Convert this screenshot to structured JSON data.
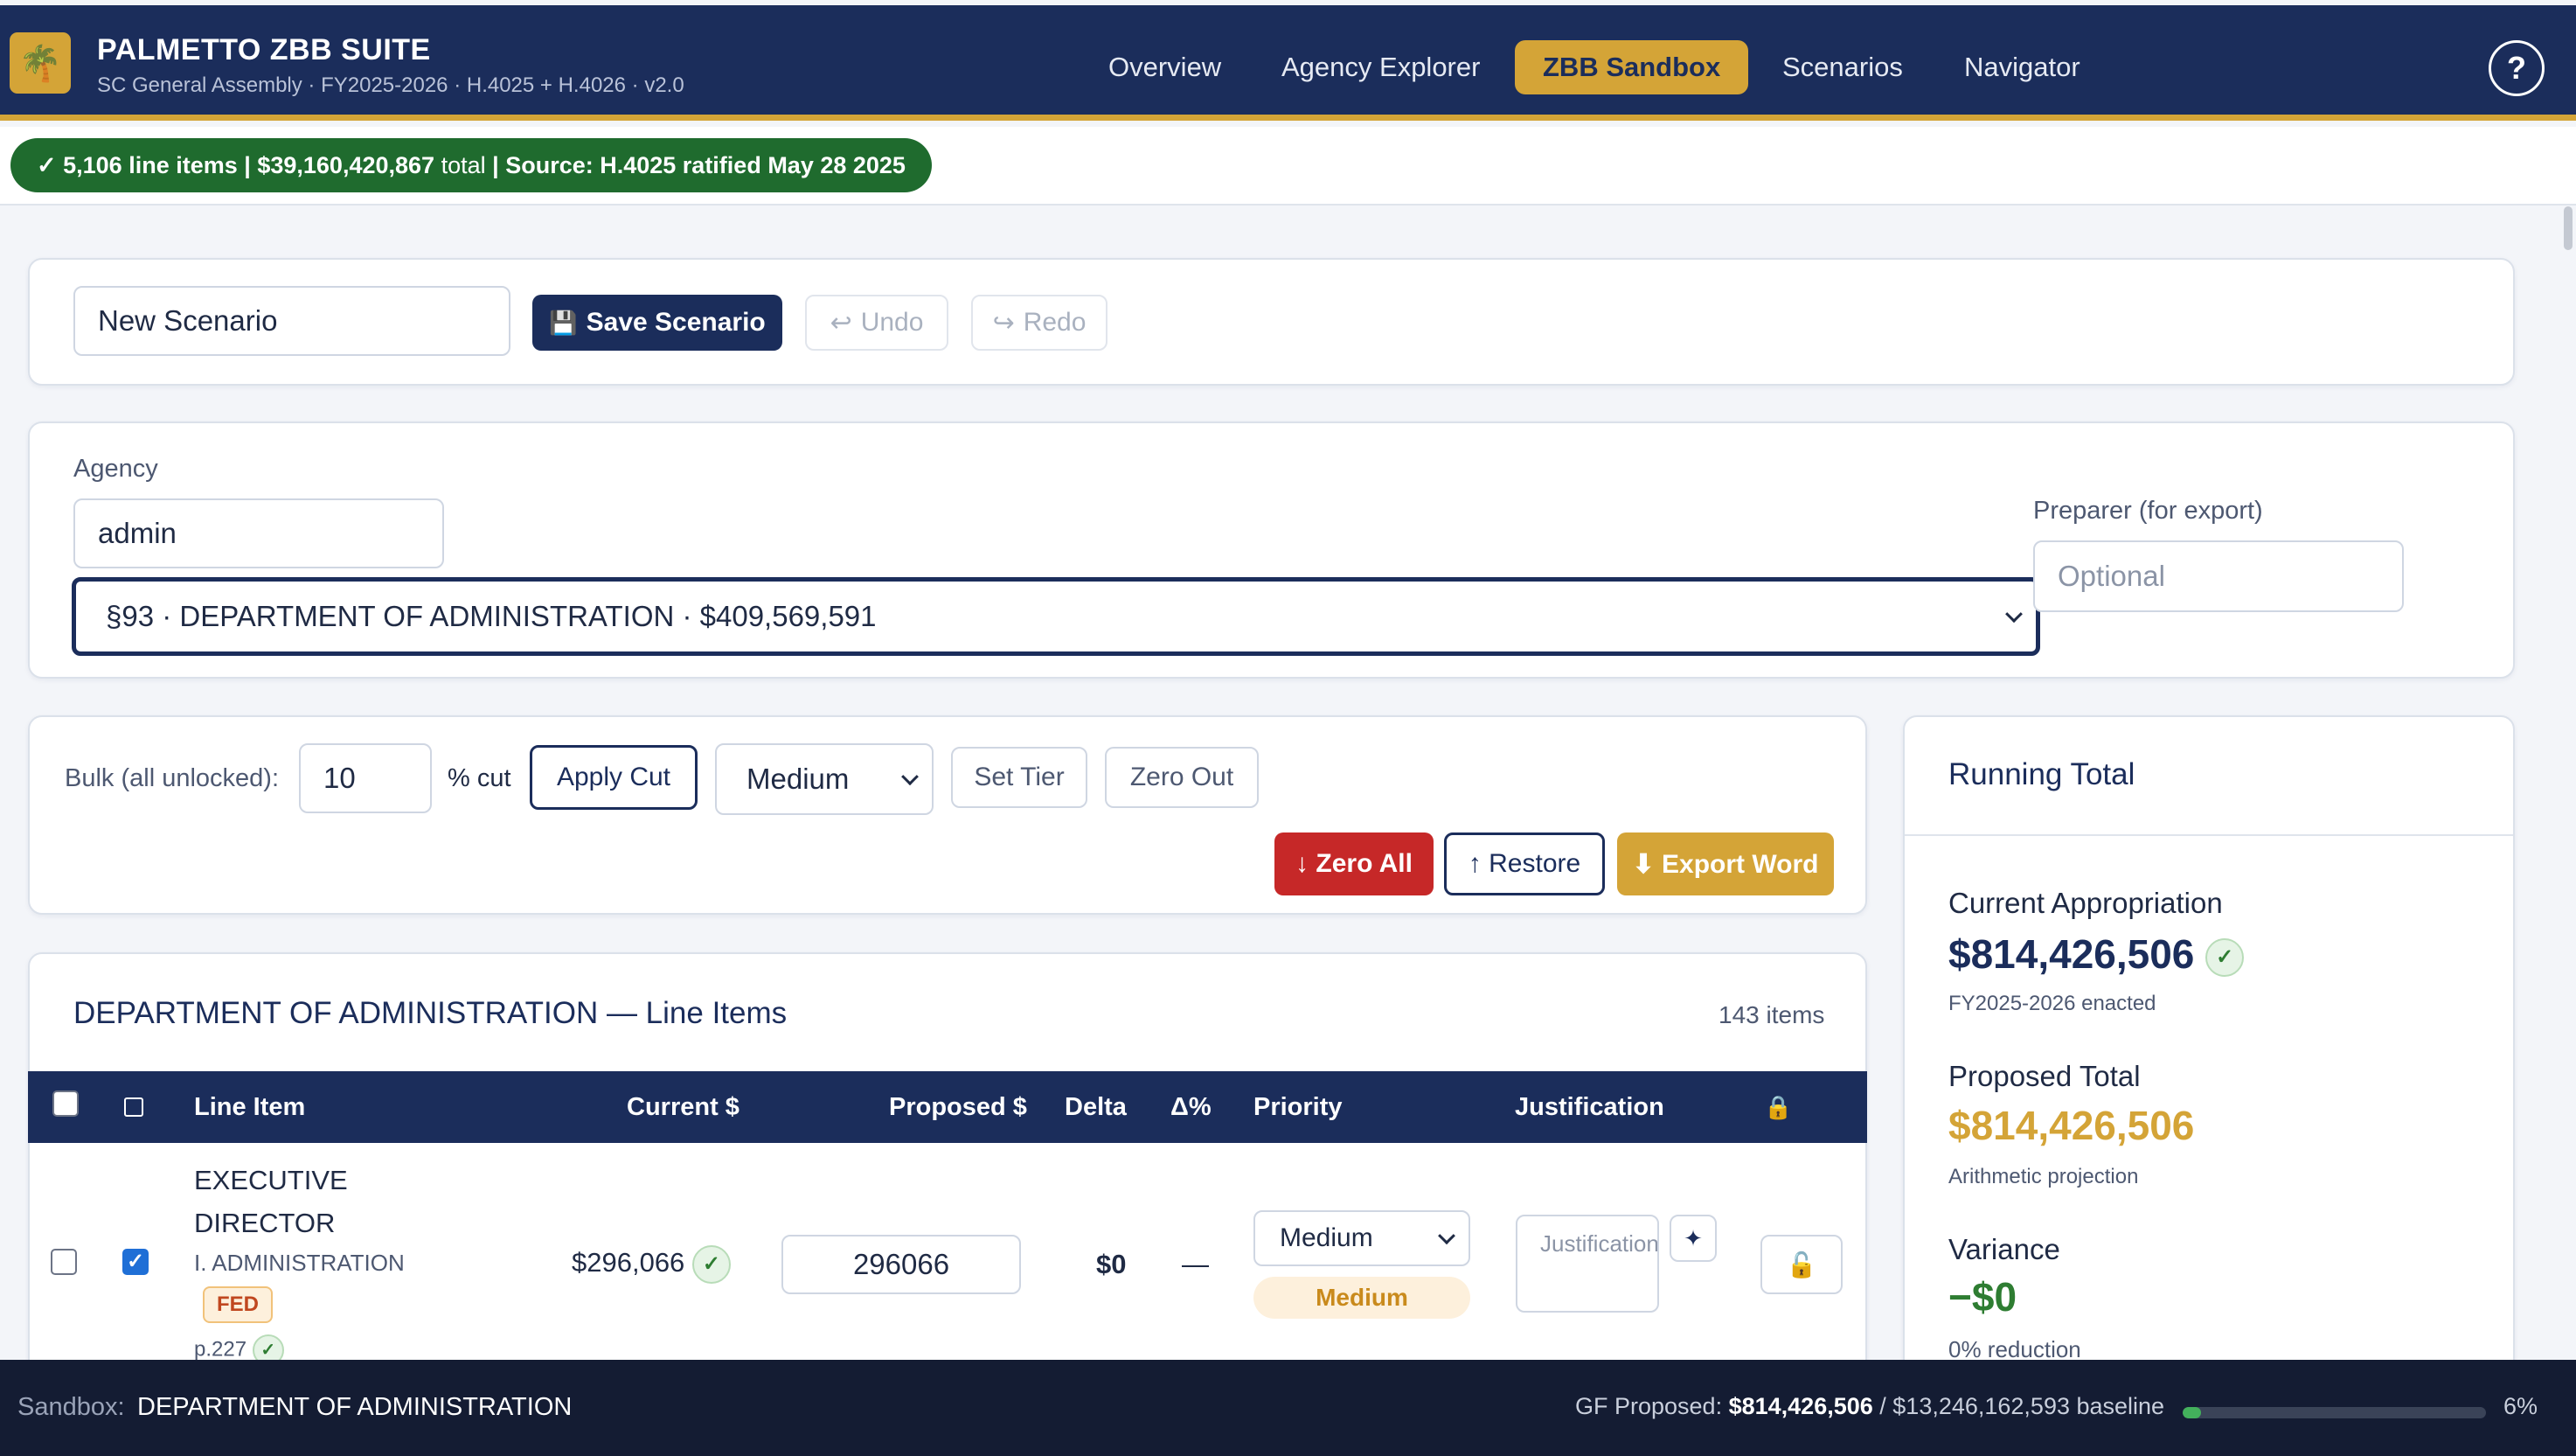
{
  "app": {
    "title": "PALMETTO ZBB SUITE",
    "subtitle": "SC General Assembly · FY2025-2026 · H.4025 + H.4026 · v2.0",
    "nav": [
      "Overview",
      "Agency Explorer",
      "ZBB Sandbox",
      "Scenarios",
      "Navigator"
    ],
    "active_nav": "ZBB Sandbox",
    "help": "?"
  },
  "status": {
    "line_items": "✓ 5,106 line items",
    "sep1": "|",
    "total_amount": "$39,160,420,867",
    "total_word": "total",
    "sep2": "|",
    "source": "Source: H.4025 ratified May 28 2025"
  },
  "scenario": {
    "name_value": "New Scenario",
    "save_label": "Save Scenario",
    "undo_label": "Undo",
    "redo_label": "Redo"
  },
  "agency": {
    "label": "Agency",
    "search_value": "admin",
    "selected": "§93 · DEPARTMENT OF ADMINISTRATION · $409,569,591",
    "preparer_label": "Preparer (for export)",
    "preparer_placeholder": "Optional"
  },
  "bulk": {
    "label": "Bulk (all unlocked):",
    "percent_value": "10",
    "percent_suffix": "% cut",
    "apply_label": "Apply Cut",
    "tier_value": "Medium",
    "set_tier_label": "Set Tier",
    "zero_out_label": "Zero Out",
    "zero_all_label": "↓ Zero All",
    "restore_label": "↑ Restore",
    "export_label": "⬇ Export Word"
  },
  "line_items": {
    "title": "DEPARTMENT OF ADMINISTRATION — Line Items",
    "count": "143 items",
    "headers": {
      "line_item": "Line Item",
      "current": "Current $",
      "proposed": "Proposed $",
      "delta": "Delta",
      "delta_pct": "Δ%",
      "priority": "Priority",
      "justification": "Justification",
      "lock": "🔒"
    },
    "rows": [
      {
        "name_line1": "EXECUTIVE",
        "name_line2": "DIRECTOR",
        "program": "I. ADMINISTRATION",
        "fund_tag": "FED",
        "page_ref": "p.227",
        "current": "$296,066",
        "proposed": "296066",
        "delta": "$0",
        "delta_pct": "—",
        "priority": "Medium",
        "priority_badge": "Medium",
        "justification_placeholder": "Justification…",
        "selected": false,
        "checked": true
      }
    ]
  },
  "running_total": {
    "title": "Running Total",
    "current_label": "Current Appropriation",
    "current_value": "$814,426,506",
    "current_note": "FY2025-2026 enacted",
    "proposed_label": "Proposed Total",
    "proposed_value": "$814,426,506",
    "proposed_note": "Arithmetic projection",
    "variance_label": "Variance",
    "variance_value": "−$0",
    "variance_note": "0% reduction"
  },
  "bottom": {
    "sandbox_label": "Sandbox:",
    "sandbox_agency": "DEPARTMENT OF ADMINISTRATION",
    "gf_label": "GF Proposed:",
    "gf_value": "$814,426,506",
    "gf_baseline": "/ $13,246,162,593 baseline",
    "pct_text": "6%",
    "progress_fraction": 0.06
  },
  "colors": {
    "navy": "#1b2d5b",
    "gold": "#d4a437",
    "green_status": "#1f6b2e",
    "red": "#c62828",
    "variance_green": "#2e7d32"
  }
}
